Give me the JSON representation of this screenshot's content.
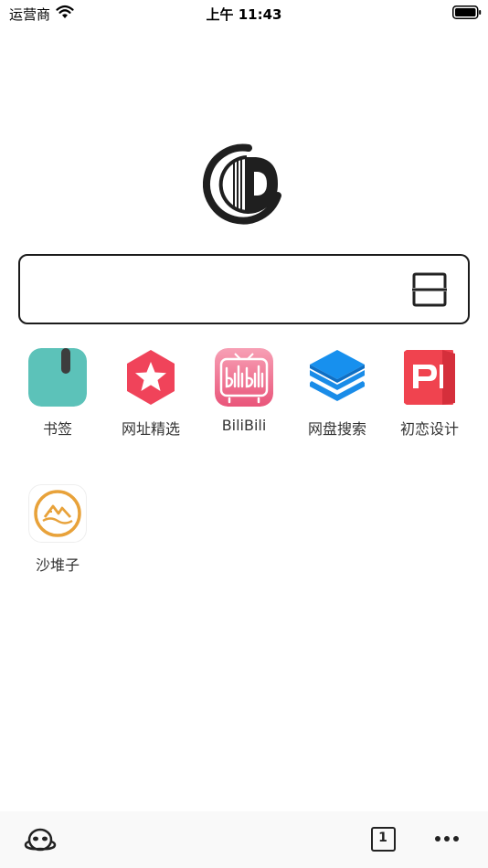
{
  "status_bar": {
    "carrier": "运营商",
    "time": "上午 11:43",
    "wifi_icon": "wifi-icon",
    "battery_icon": "battery-icon"
  },
  "logo": {
    "icon": "book-d-logo",
    "color": "#1f1f1f"
  },
  "search": {
    "value": "",
    "placeholder": "",
    "scan_icon": "scan-icon"
  },
  "shortcuts": [
    {
      "label": "书签",
      "icon": "bookmark-icon",
      "color": "#5cc2b9"
    },
    {
      "label": "网址精选",
      "icon": "star-hexagon-icon",
      "color": "#f0435a"
    },
    {
      "label": "BiliBili",
      "icon": "bilibili-tv-icon",
      "color": "#f07b98"
    },
    {
      "label": "网盘搜索",
      "icon": "layers-icon",
      "color": "#1a8ce8"
    },
    {
      "label": "初恋设计",
      "icon": "p-logo-icon",
      "color": "#f0434f"
    },
    {
      "label": "沙堆子",
      "icon": "sand-logo-icon",
      "color": "#e8a23a"
    }
  ],
  "bottom_bar": {
    "alien_icon": "alien-icon",
    "tab_count": "1",
    "more_icon": "more-icon"
  }
}
